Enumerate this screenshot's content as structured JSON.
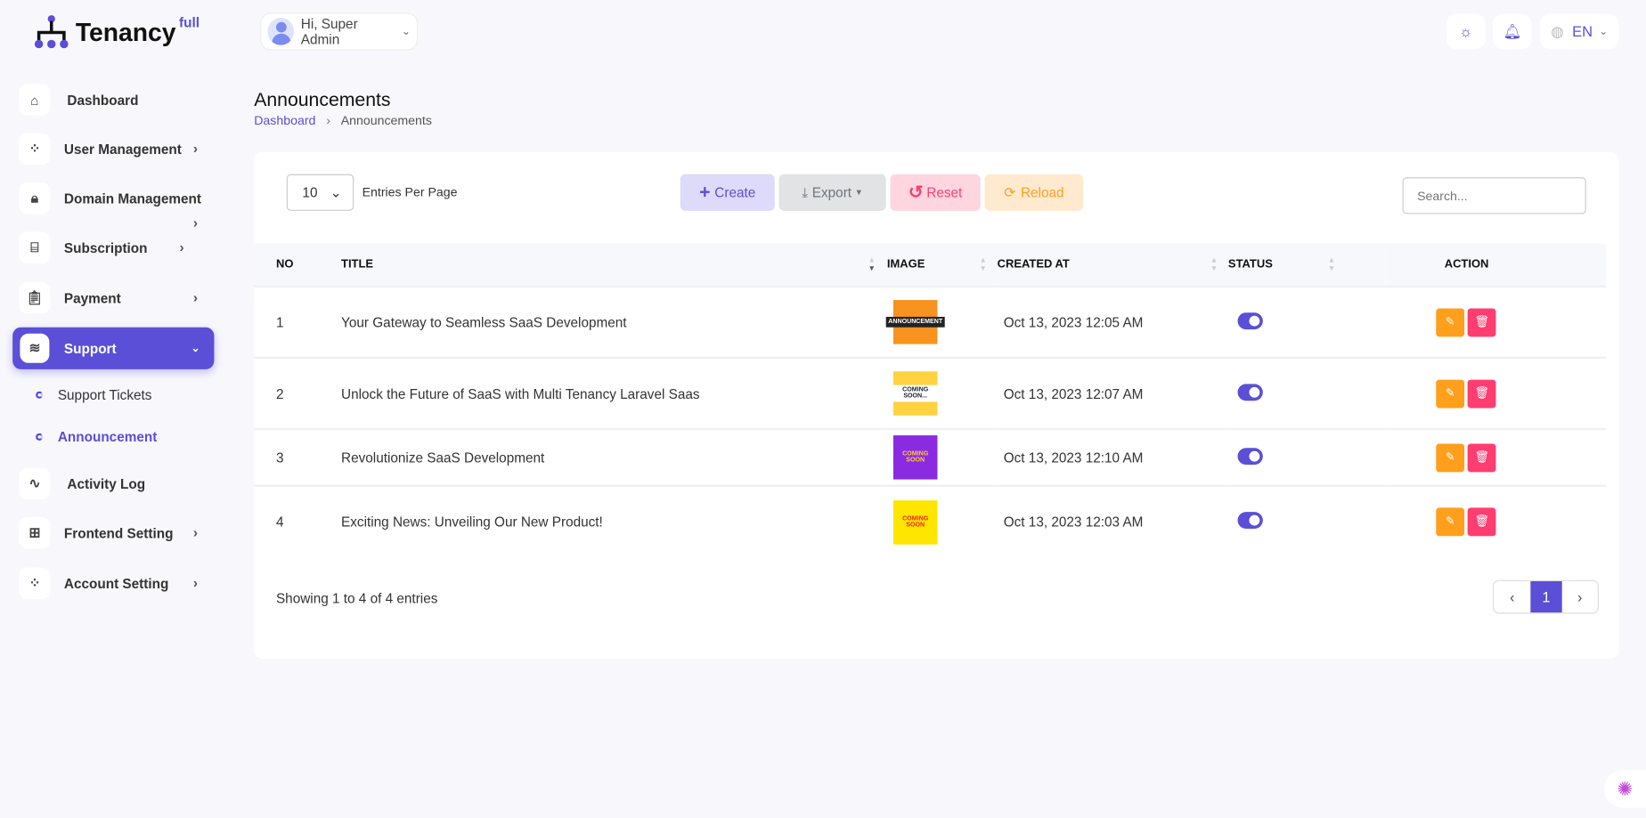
{
  "brand": {
    "name": "Tenancy",
    "sup": "full"
  },
  "header": {
    "greeting": "Hi, Super Admin",
    "language": "EN"
  },
  "sidebar": {
    "items": [
      {
        "label": "Dashboard"
      },
      {
        "label": "User Management"
      },
      {
        "label": "Domain Management"
      },
      {
        "label": "Subscription"
      },
      {
        "label": "Payment"
      },
      {
        "label": "Support"
      },
      {
        "label": "Activity Log"
      },
      {
        "label": "Frontend Setting"
      },
      {
        "label": "Account Setting"
      }
    ],
    "support_sub": [
      {
        "label": "Support Tickets"
      },
      {
        "label": "Announcement"
      }
    ]
  },
  "page": {
    "title": "Announcements",
    "breadcrumb": [
      "Dashboard",
      "Announcements"
    ]
  },
  "toolbar": {
    "entries_value": "10",
    "entries_label": "Entries Per Page",
    "create": "Create",
    "export": "Export",
    "reset": "Reset",
    "reload": "Reload",
    "search_placeholder": "Search..."
  },
  "table": {
    "headers": [
      "NO",
      "TITLE",
      "IMAGE",
      "CREATED AT",
      "STATUS",
      "ACTION"
    ],
    "rows": [
      {
        "no": "1",
        "title": "Your Gateway to Seamless SaaS Development",
        "image_text": "ANNOUNCEMENT",
        "created": "Oct 13, 2023 12:05 AM",
        "status": true
      },
      {
        "no": "2",
        "title": "Unlock the Future of SaaS with Multi Tenancy Laravel Saas",
        "image_text": "COMING SOON...",
        "created": "Oct 13, 2023 12:07 AM",
        "status": true
      },
      {
        "no": "3",
        "title": "Revolutionize SaaS Development",
        "image_text": "COMING SOON",
        "created": "Oct 13, 2023 12:10 AM",
        "status": true
      },
      {
        "no": "4",
        "title": "Exciting News: Unveiling Our New Product!",
        "image_text": "COMING SOON",
        "created": "Oct 13, 2023 12:03 AM",
        "status": true
      }
    ]
  },
  "footer": {
    "info": "Showing 1 to 4 of 4 entries",
    "current_page": "1",
    "prev": "‹",
    "next": "›"
  },
  "colors": {
    "accent": "#5a4fd6",
    "edit": "#ff9f1c",
    "delete": "#ff3d71"
  }
}
